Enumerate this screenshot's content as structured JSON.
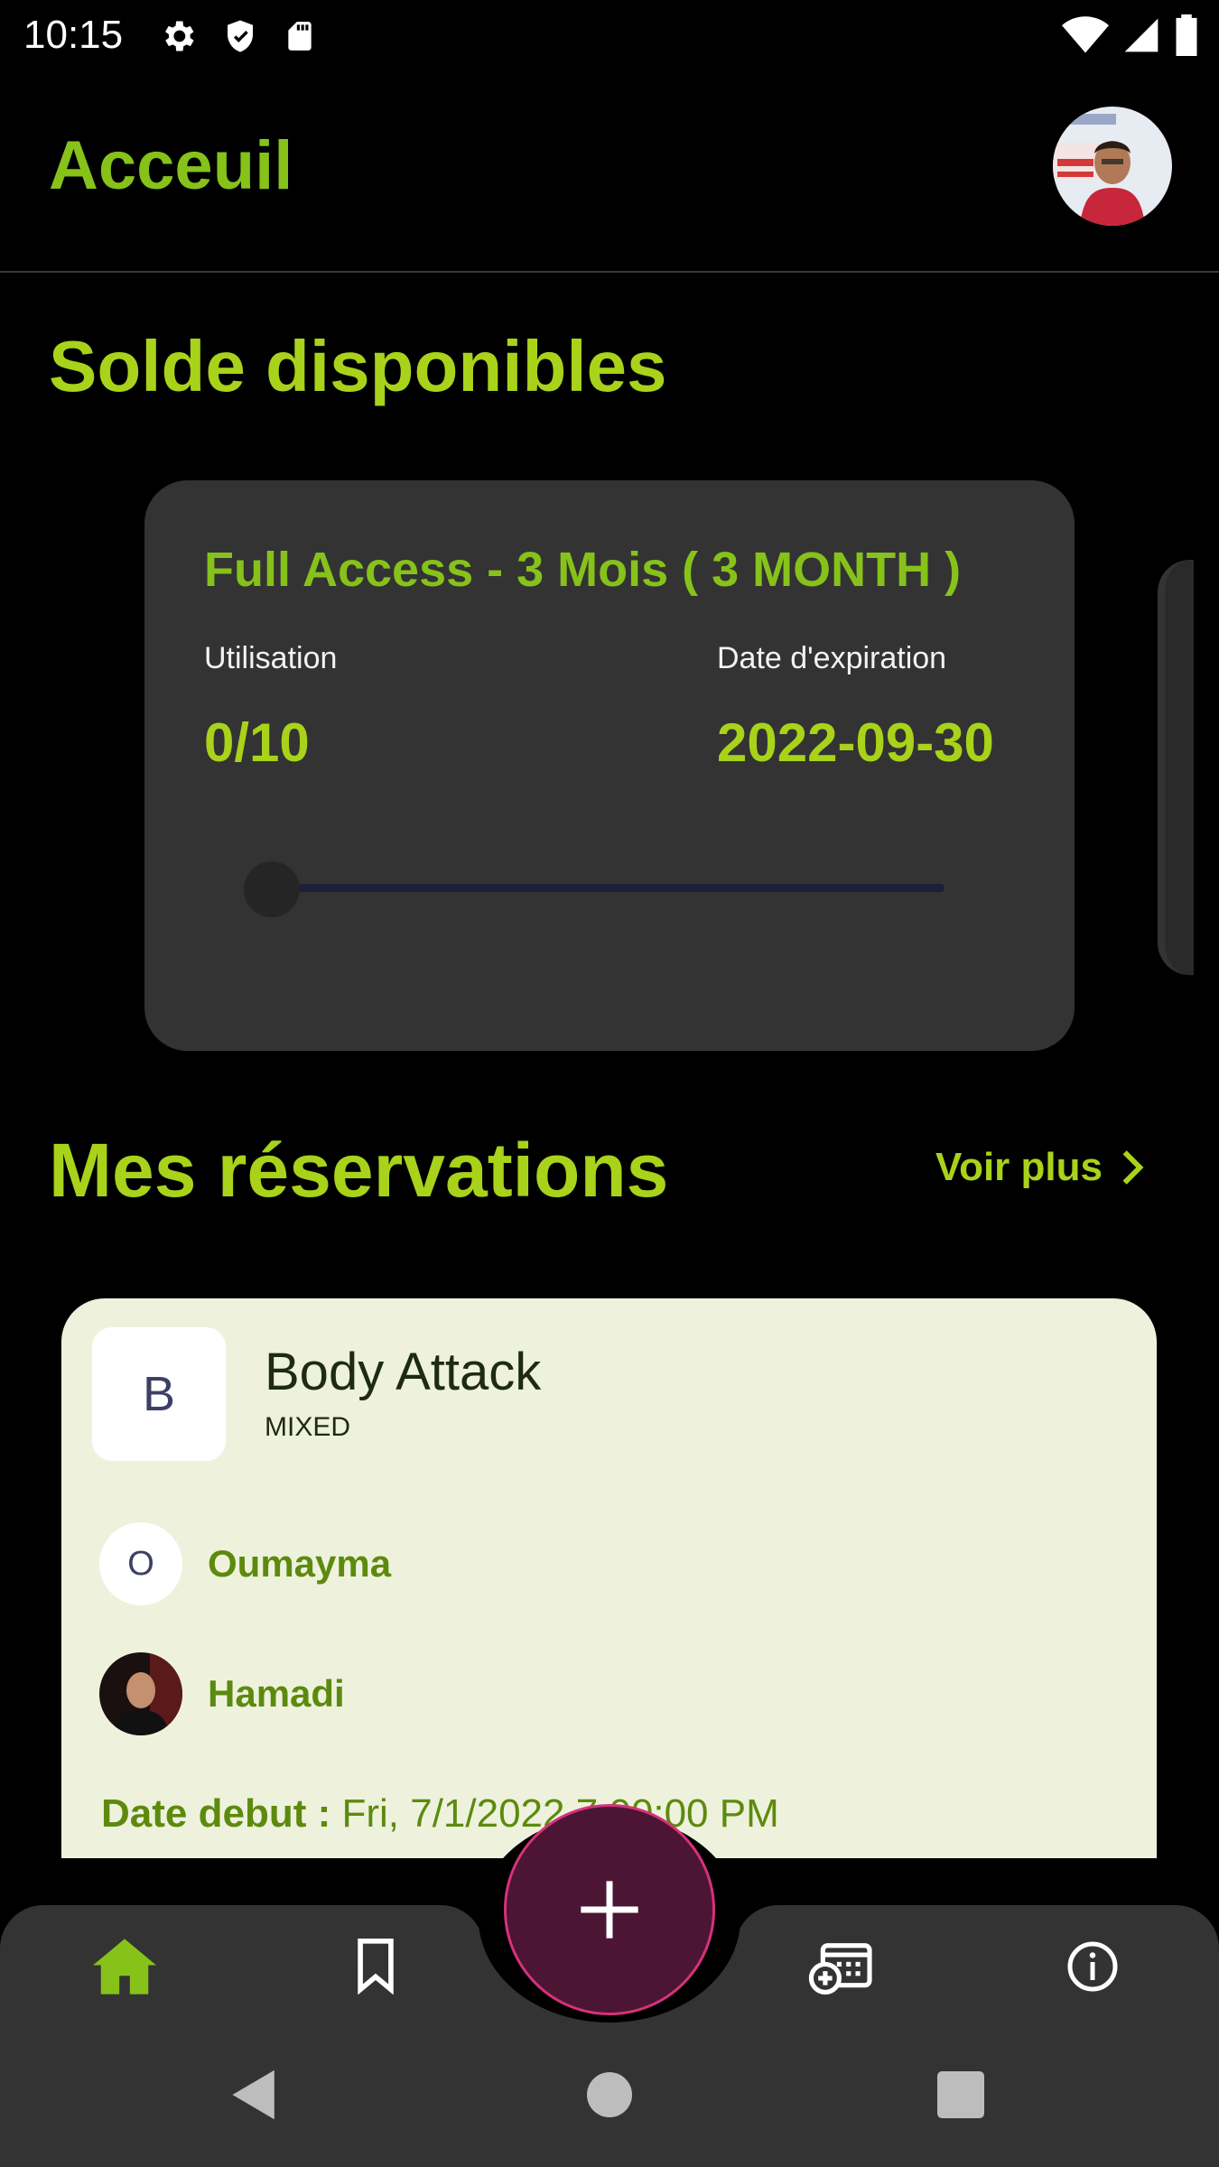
{
  "status_bar": {
    "time": "10:15"
  },
  "app_bar": {
    "title": "Acceuil"
  },
  "solde": {
    "section_title": "Solde disponibles",
    "card": {
      "name": "Full Access - 3 Mois ( 3 MONTH )",
      "usage_label": "Utilisation",
      "usage_value": "0/10",
      "usage_progress": 0,
      "expiration_label": "Date d'expiration",
      "expiration_value": "2022-09-30"
    }
  },
  "reservations": {
    "section_title": "Mes réservations",
    "voir_plus": "Voir plus",
    "items": [
      {
        "class_initial": "B",
        "class_name": "Body Attack",
        "class_type": "MIXED",
        "people": [
          {
            "initial": "O",
            "name": "Oumayma"
          },
          {
            "name": "Hamadi"
          }
        ],
        "date_label": "Date debut :",
        "date_value": "Fri, 7/1/2022 7:00:00 PM"
      }
    ]
  },
  "bottom_nav": {
    "items": [
      "home-icon",
      "bookmark-icon",
      "add-fab",
      "calendar-add-icon",
      "info-icon"
    ],
    "active": "home-icon"
  },
  "colors": {
    "accent": "#86c21a",
    "accent_bright": "#a9d21a",
    "fab": "#4b1533",
    "card": "#333333",
    "reservation_card": "#eef2dc"
  }
}
